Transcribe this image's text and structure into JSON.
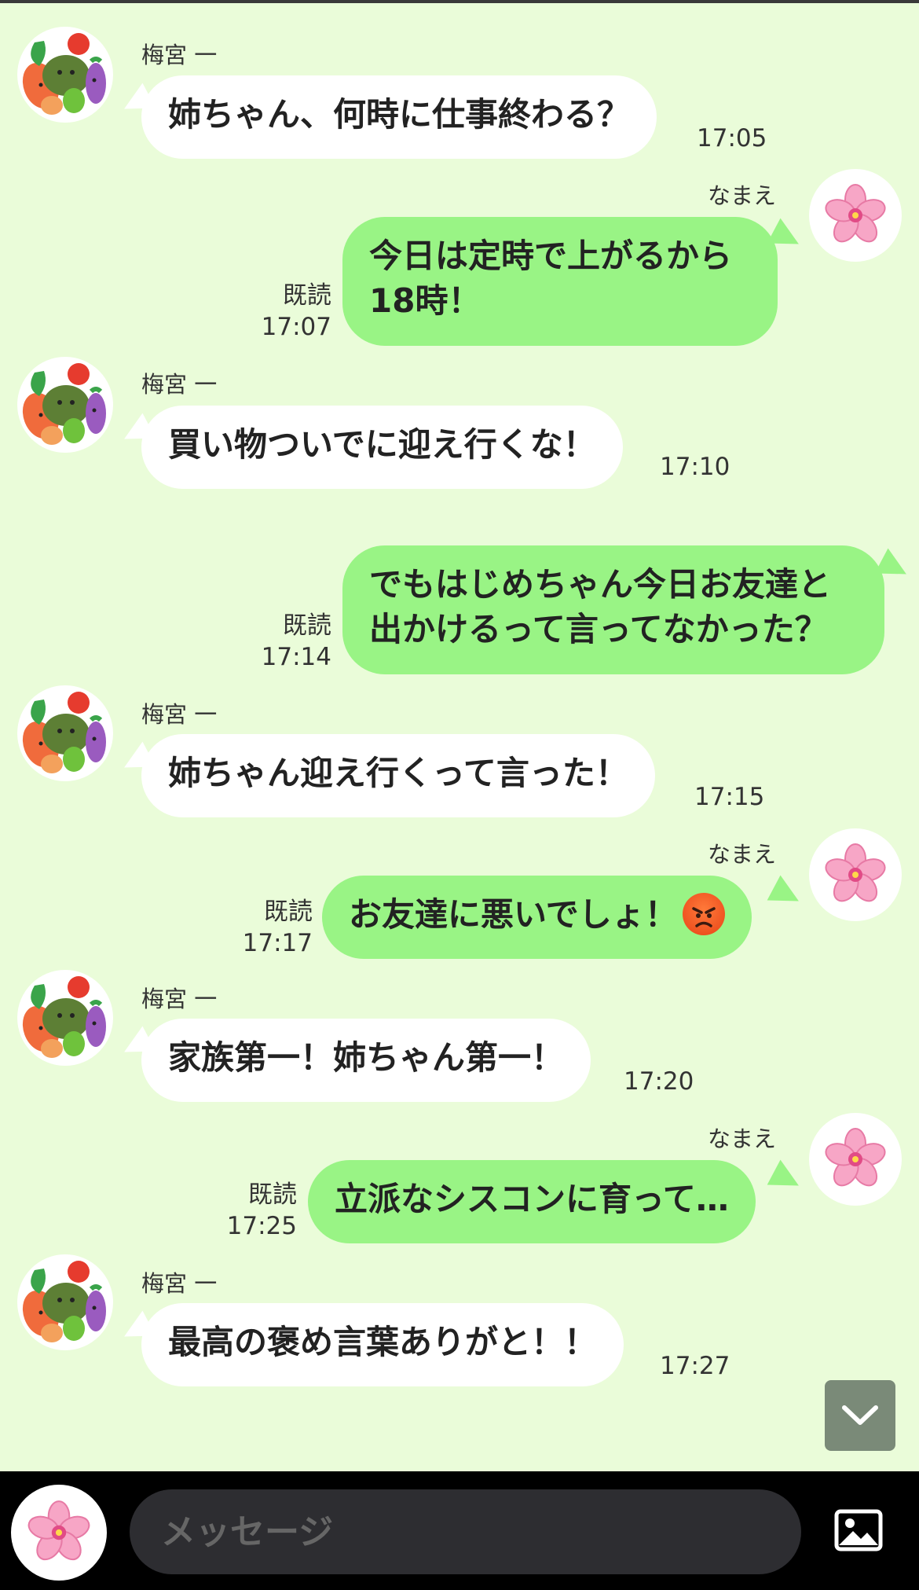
{
  "colors": {
    "background": "#eafcd9",
    "incoming_bubble": "#ffffff",
    "outgoing_bubble": "#99f485",
    "input_bg": "#2d2d31",
    "bottom_bar": "#000000"
  },
  "messages": [
    {
      "side": "left",
      "sender": "梅宮 一",
      "text": "姉ちゃん、何時に仕事終わる？",
      "time": "17:05"
    },
    {
      "side": "right",
      "sender": "なまえ",
      "lines": [
        "今日は定時で上がるから",
        "18時！"
      ],
      "read": "既読",
      "time": "17:07"
    },
    {
      "side": "left",
      "sender": "梅宮 一",
      "text": "買い物ついでに迎え行くな！",
      "time": "17:10"
    },
    {
      "side": "right",
      "lines": [
        "でもはじめちゃん今日お友達と",
        "出かけるって言ってなかった？"
      ],
      "read": "既読",
      "time": "17:14"
    },
    {
      "side": "left",
      "sender": "梅宮 一",
      "text": "姉ちゃん迎え行くって言った！",
      "time": "17:15"
    },
    {
      "side": "right",
      "sender": "なまえ",
      "text": "お友達に悪いでしょ！",
      "emoji": "angry-face",
      "read": "既読",
      "time": "17:17"
    },
    {
      "side": "left",
      "sender": "梅宮 一",
      "text": "家族第一！姉ちゃん第一！",
      "time": "17:20"
    },
    {
      "side": "right",
      "sender": "なまえ",
      "text": "立派なシスコンに育って…",
      "read": "既読",
      "time": "17:25"
    },
    {
      "side": "left",
      "sender": "梅宮 一",
      "text": "最高の褒め言葉ありがと！！",
      "time": "17:27"
    }
  ],
  "input": {
    "placeholder": "メッセージ"
  },
  "icons": {
    "scroll": "chevron-down-icon",
    "image": "image-icon",
    "avatar_me": "cherry-blossom-icon",
    "avatar_other": "vegetables-icon"
  }
}
